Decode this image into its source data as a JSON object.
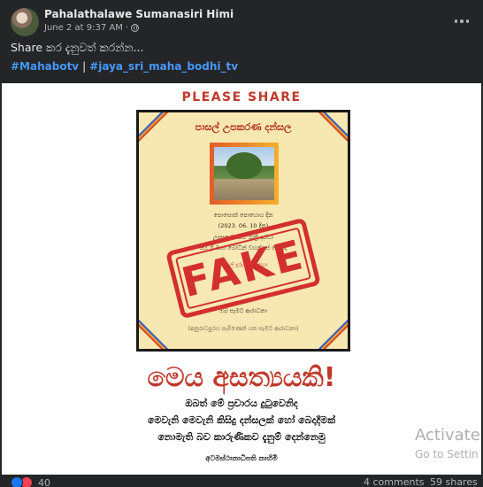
{
  "post": {
    "author": "Pahalathalawe Sumanasiri Himi",
    "timestamp": "June 2 at 9:37 AM",
    "privacy_icon": "globe-icon",
    "text": "Share කර දැනුවත් කරන්න...",
    "hashtags": [
      "#Mahabotv",
      "#jaya_sri_maha_bodhi_tv"
    ],
    "hashtag_separator": "|"
  },
  "image": {
    "banner": "PLEASE SHARE",
    "poster_title": "පාසල් උපකරණ දන්සල",
    "poster_lines": [
      "පොසොන් පොහොය දින",
      "(2023. 06. 10 දින)",
      "උදෑසන 5. සිට රාත්‍රී දක්වා",
      "ජය ශ්‍රී මහා බෝධීන් වහන්සේ වෙතදී",
      "පාසල් දරුවන් සඳහා",
      "ඔබ සැමට ආරාධනා"
    ],
    "poster_footer": "(අනුරාධපුරය පැමිණෙන් යන සැමට ආරාධනා)",
    "stamp": "FAKE",
    "headline": "මෙය අසත්‍යයකි!",
    "sub_lines": [
      "ඔබත් මේ ප්‍රචාරය දුටුවෙනිද",
      "මෙවැනි මෙවැනි කිසිදු දන්සලක් හෝ බෙදාදීමක්",
      "නොමැති බව කාරුණිකව දැනුම් දෙන්නෙමු"
    ],
    "signature": "අටමස්ථානාධිපති නාහිමි"
  },
  "watermark": {
    "title": "Activate",
    "subtitle": "Go to Settin"
  },
  "footer": {
    "reaction_count": "40",
    "comments": "4 comments",
    "shares": "59 shares"
  },
  "colors": {
    "accent_link": "#4599ff",
    "headline_red": "#c0392b",
    "stamp_red": "#d32f2f",
    "poster_bg": "#f7e7b0"
  }
}
